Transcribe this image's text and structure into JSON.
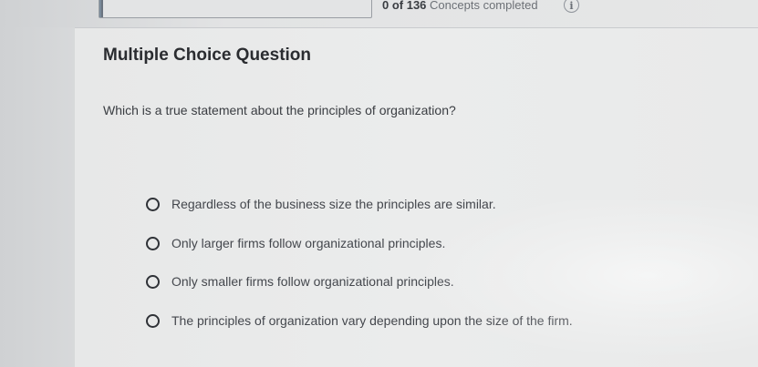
{
  "progress": {
    "count": "0 of 136",
    "label": "Concepts completed",
    "value": 0,
    "total": 136
  },
  "info_icon": {
    "glyph": "i",
    "icon": "info-icon"
  },
  "question": {
    "type_label": "Multiple Choice Question",
    "prompt": "Which is a true statement about the principles of organization?"
  },
  "options": [
    {
      "label": "Regardless of the business size the principles are similar.",
      "selected": false
    },
    {
      "label": "Only larger firms follow organizational principles.",
      "selected": false
    },
    {
      "label": "Only smaller firms follow organizational principles.",
      "selected": false
    },
    {
      "label": "The principles of organization vary depending upon the size of the firm.",
      "selected": false
    }
  ]
}
